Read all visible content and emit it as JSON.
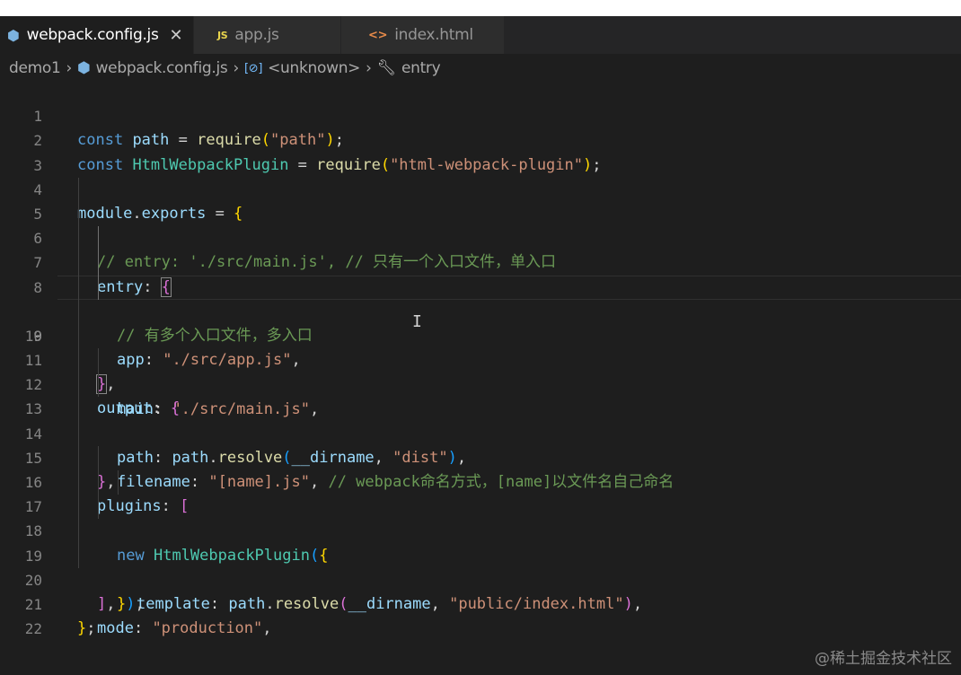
{
  "tabs": [
    {
      "label": "webpack.config.js",
      "icon": "webpack-icon",
      "active": true,
      "close": "✕"
    },
    {
      "label": "app.js",
      "icon": "js-icon",
      "icon_text": "JS",
      "active": false
    },
    {
      "label": "index.html",
      "icon": "html-icon",
      "icon_text": "<>",
      "active": false
    }
  ],
  "breadcrumb": {
    "folder": "demo1",
    "file": "webpack.config.js",
    "symbol": "<unknown>",
    "property": "entry"
  },
  "editor": {
    "current_line": 9,
    "lines": [
      {
        "n": "1"
      },
      {
        "n": "2"
      },
      {
        "n": "3"
      },
      {
        "n": "4"
      },
      {
        "n": "5"
      },
      {
        "n": "6"
      },
      {
        "n": "7"
      },
      {
        "n": "8"
      },
      {
        "n": "9"
      },
      {
        "n": "10"
      },
      {
        "n": "11"
      },
      {
        "n": "12"
      },
      {
        "n": "13"
      },
      {
        "n": "14"
      },
      {
        "n": "15"
      },
      {
        "n": "16"
      },
      {
        "n": "17"
      },
      {
        "n": "18"
      },
      {
        "n": "19"
      },
      {
        "n": "20"
      },
      {
        "n": "21"
      },
      {
        "n": "22"
      }
    ],
    "code": {
      "l1": {
        "t1": "const",
        "t2": "path",
        "t3": " = ",
        "t4": "require",
        "t5": "(",
        "t6": "\"path\"",
        "t7": ");"
      },
      "l2": {
        "t1": "const",
        "t2": "HtmlWebpackPlugin",
        "t3": " = ",
        "t4": "require",
        "t5": "(",
        "t6": "\"html-webpack-plugin\"",
        "t7": ");"
      },
      "l4": {
        "t1": "module",
        "t2": ".",
        "t3": "exports",
        "t4": " = ",
        "t5": "{"
      },
      "l5": {
        "t1": "// entry: './src/main.js', // 只有一个入口文件，单入口"
      },
      "l6": {
        "t1": "entry",
        "t2": ": ",
        "t3": "{"
      },
      "l7": {
        "t1": "// 有多个入口文件，多入口"
      },
      "l8": {
        "t1": "app",
        "t2": ": ",
        "t3": "\"./src/app.js\"",
        "t4": ","
      },
      "l9": {
        "t1": "main",
        "t2": ": ",
        "t3": "\"./src/main.js\"",
        "t4": ","
      },
      "l10": {
        "t1": "}",
        "t2": ","
      },
      "l11": {
        "t1": "output",
        "t2": ": ",
        "t3": "{"
      },
      "l12": {
        "t1": "path",
        "t2": ": ",
        "t3": "path",
        "t4": ".",
        "t5": "resolve",
        "t6": "(",
        "t7": "__dirname",
        "t8": ", ",
        "t9": "\"dist\"",
        "t10": "),"
      },
      "l13": {
        "t1": "filename",
        "t2": ": ",
        "t3": "\"[name].js\"",
        "t4": ", ",
        "t5": "// webpack命名方式，[name]以文件名自己命名"
      },
      "l14": {
        "t1": "}",
        "t2": ","
      },
      "l15": {
        "t1": "plugins",
        "t2": ": ",
        "t3": "["
      },
      "l16": {
        "t1": "new",
        "t2": " ",
        "t3": "HtmlWebpackPlugin",
        "t4": "(",
        "t5": "{"
      },
      "l17": {
        "t1": "template",
        "t2": ": ",
        "t3": "path",
        "t4": ".",
        "t5": "resolve",
        "t6": "(",
        "t7": "__dirname",
        "t8": ", ",
        "t9": "\"public/index.html\"",
        "t10": "),"
      },
      "l18": {
        "t1": "}",
        "t2": ")",
        "t3": ","
      },
      "l19": {
        "t1": "]",
        "t2": ","
      },
      "l20": {
        "t1": "mode",
        "t2": ": ",
        "t3": "\"production\"",
        "t4": ","
      },
      "l21": {
        "t1": "}",
        "t2": ";"
      }
    }
  },
  "cursor_glyph": "I",
  "watermark": "@稀土掘金技术社区"
}
